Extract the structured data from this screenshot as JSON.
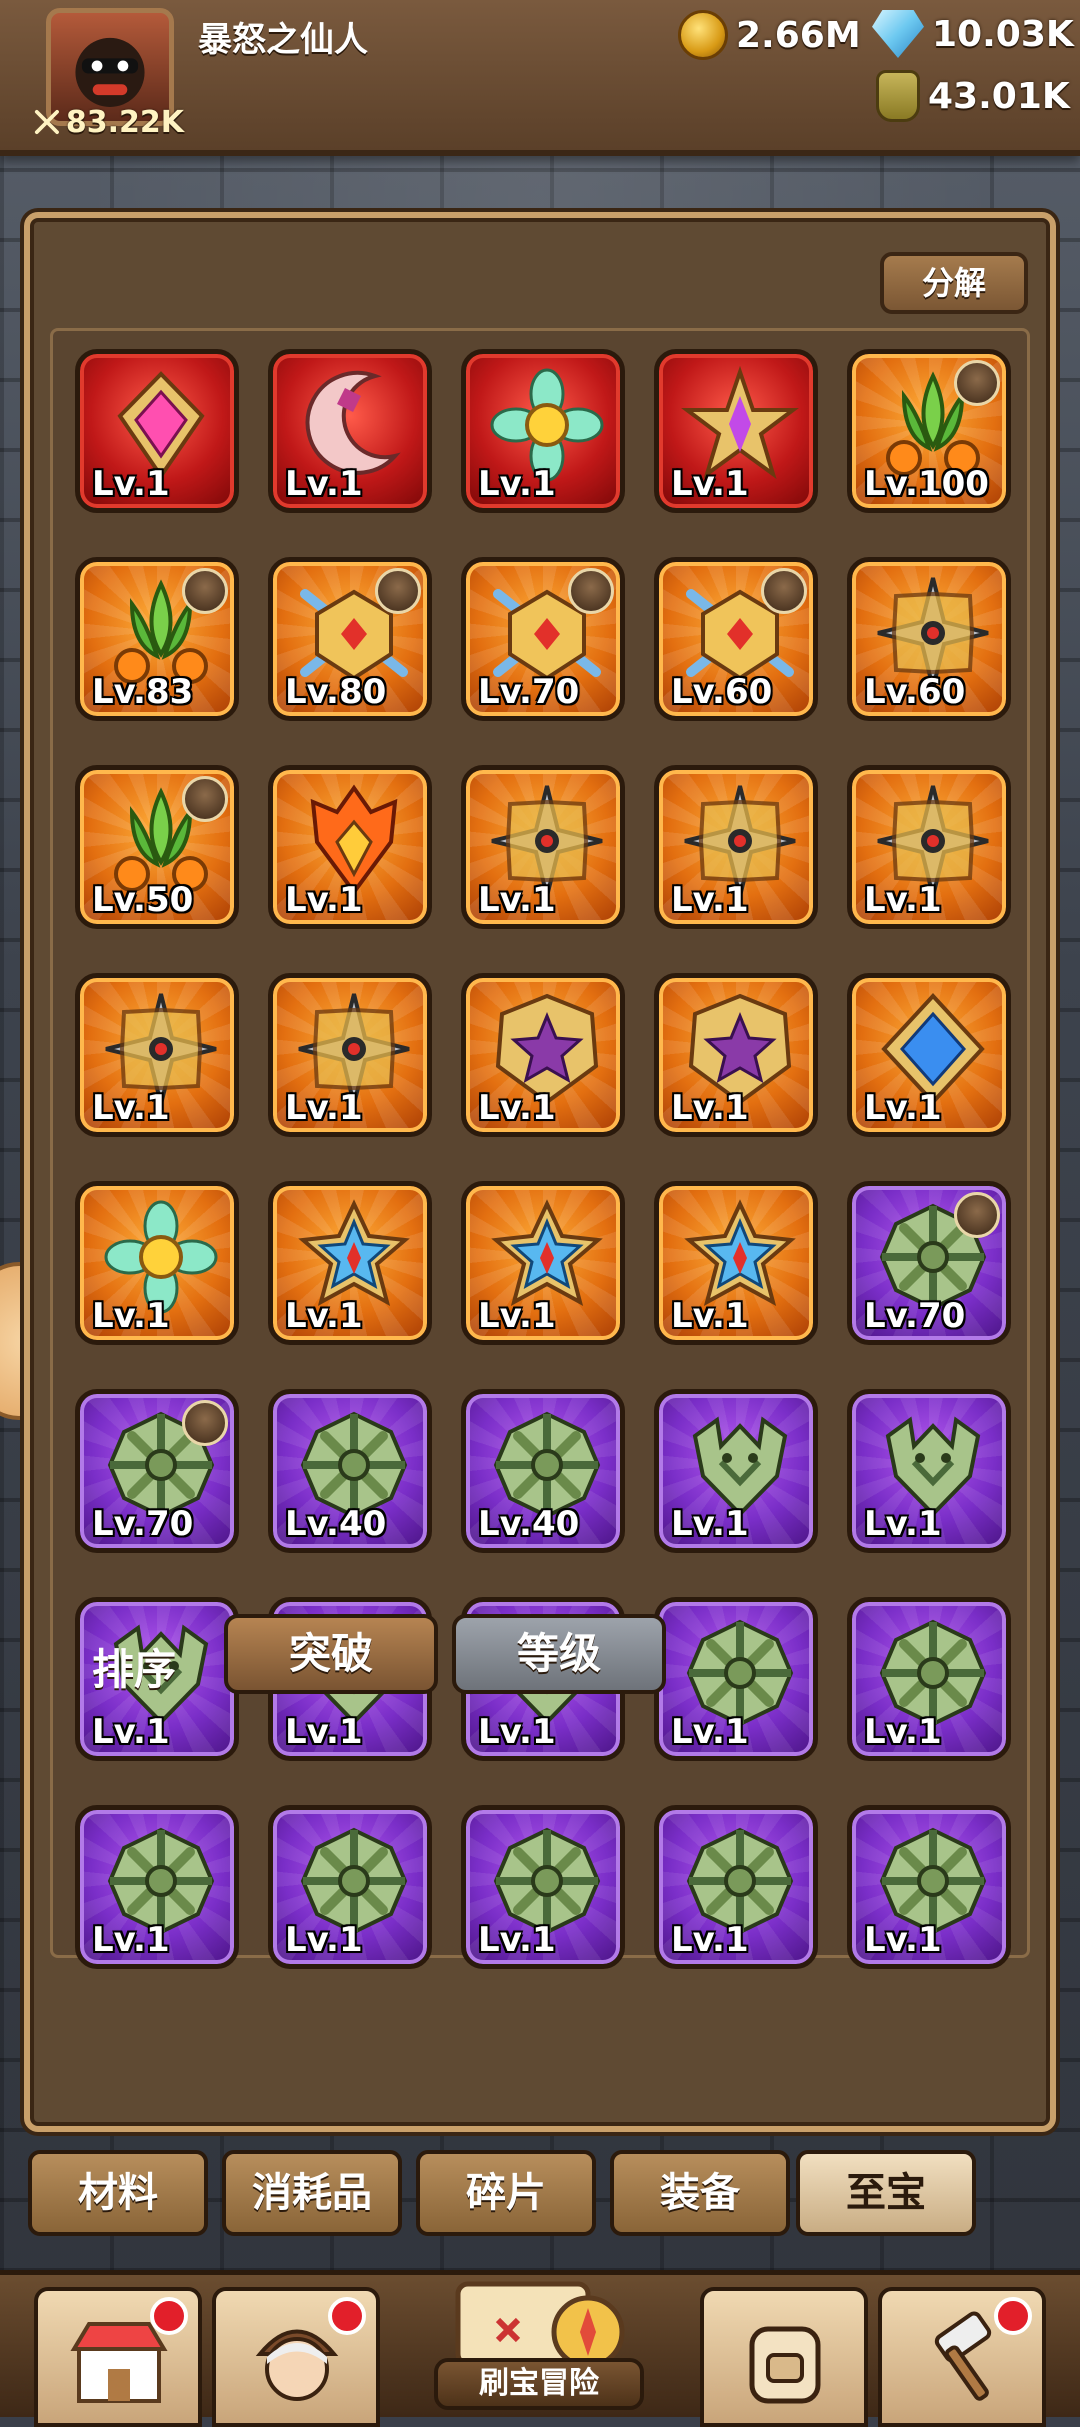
{
  "header": {
    "username": "暴怒之仙人",
    "power": "83.22K",
    "gold": "2.66M",
    "diamonds": "10.03K",
    "potion": "43.01K"
  },
  "panel": {
    "decompose_label": "分解",
    "sort_label": "排序",
    "sort_options": [
      "突破",
      "等级"
    ],
    "sort_selected": "突破"
  },
  "items": [
    {
      "level": "Lv.1",
      "rarity": "red",
      "icon": "pink-gem-icon"
    },
    {
      "level": "Lv.1",
      "rarity": "red",
      "icon": "crescent-moon-icon"
    },
    {
      "level": "Lv.1",
      "rarity": "red",
      "icon": "flower-gem-icon"
    },
    {
      "level": "Lv.1",
      "rarity": "red",
      "icon": "purple-star-icon"
    },
    {
      "level": "Lv.100",
      "rarity": "orange",
      "icon": "leaf-orb-icon",
      "hero": true
    },
    {
      "level": "Lv.83",
      "rarity": "orange",
      "icon": "leaf-orb-icon",
      "hero": true
    },
    {
      "level": "Lv.80",
      "rarity": "orange",
      "icon": "crossed-shield-icon",
      "hero": true
    },
    {
      "level": "Lv.70",
      "rarity": "orange",
      "icon": "crossed-shield-icon",
      "hero": true
    },
    {
      "level": "Lv.60",
      "rarity": "orange",
      "icon": "crossed-shield-icon",
      "hero": true
    },
    {
      "level": "Lv.60",
      "rarity": "orange",
      "icon": "shuriken-icon"
    },
    {
      "level": "Lv.50",
      "rarity": "orange",
      "icon": "leaf-orb-icon",
      "hero": true
    },
    {
      "level": "Lv.1",
      "rarity": "orange",
      "icon": "flame-helmet-icon"
    },
    {
      "level": "Lv.1",
      "rarity": "orange",
      "icon": "shuriken-icon"
    },
    {
      "level": "Lv.1",
      "rarity": "orange",
      "icon": "shuriken-icon"
    },
    {
      "level": "Lv.1",
      "rarity": "orange",
      "icon": "shuriken-icon"
    },
    {
      "level": "Lv.1",
      "rarity": "orange",
      "icon": "shuriken-icon"
    },
    {
      "level": "Lv.1",
      "rarity": "orange",
      "icon": "shuriken-icon"
    },
    {
      "level": "Lv.1",
      "rarity": "orange",
      "icon": "star-badge-icon"
    },
    {
      "level": "Lv.1",
      "rarity": "orange",
      "icon": "star-badge-icon"
    },
    {
      "level": "Lv.1",
      "rarity": "orange",
      "icon": "blue-gem-icon"
    },
    {
      "level": "Lv.1",
      "rarity": "orange",
      "icon": "flower-gem-icon"
    },
    {
      "level": "Lv.1",
      "rarity": "orange",
      "icon": "blue-star-icon"
    },
    {
      "level": "Lv.1",
      "rarity": "orange",
      "icon": "blue-star-icon"
    },
    {
      "level": "Lv.1",
      "rarity": "orange",
      "icon": "blue-star-icon"
    },
    {
      "level": "Lv.70",
      "rarity": "purple",
      "icon": "green-emblem-icon",
      "hero": true
    },
    {
      "level": "Lv.70",
      "rarity": "purple",
      "icon": "green-emblem-icon",
      "hero": true
    },
    {
      "level": "Lv.40",
      "rarity": "purple",
      "icon": "green-emblem-icon"
    },
    {
      "level": "Lv.40",
      "rarity": "purple",
      "icon": "green-emblem-icon"
    },
    {
      "level": "Lv.1",
      "rarity": "purple",
      "icon": "green-dragon-icon"
    },
    {
      "level": "Lv.1",
      "rarity": "purple",
      "icon": "green-dragon-icon"
    },
    {
      "level": "Lv.1",
      "rarity": "purple",
      "icon": "green-dragon-icon"
    },
    {
      "level": "Lv.1",
      "rarity": "purple",
      "icon": "green-dragon-icon"
    },
    {
      "level": "Lv.1",
      "rarity": "purple",
      "icon": "green-dragon-icon"
    },
    {
      "level": "Lv.1",
      "rarity": "purple",
      "icon": "green-emblem-icon"
    },
    {
      "level": "Lv.1",
      "rarity": "purple",
      "icon": "green-emblem-icon"
    },
    {
      "level": "Lv.1",
      "rarity": "purple",
      "icon": "green-emblem-icon"
    },
    {
      "level": "Lv.1",
      "rarity": "purple",
      "icon": "green-emblem-icon"
    },
    {
      "level": "Lv.1",
      "rarity": "purple",
      "icon": "green-emblem-icon"
    },
    {
      "level": "Lv.1",
      "rarity": "purple",
      "icon": "green-emblem-icon"
    },
    {
      "level": "Lv.1",
      "rarity": "purple",
      "icon": "green-emblem-icon"
    }
  ],
  "tabs": [
    {
      "label": "材料",
      "selected": false
    },
    {
      "label": "消耗品",
      "selected": false
    },
    {
      "label": "碎片",
      "selected": false
    },
    {
      "label": "装备",
      "selected": false
    },
    {
      "label": "至宝",
      "selected": true
    }
  ],
  "bottom_nav": {
    "center_label": "刷宝冒险"
  },
  "colors": {
    "panel_bg": "#5f4a33",
    "red_rarity": "#c01818",
    "orange_rarity": "#e36f10",
    "purple_rarity": "#7a2ec8",
    "notification": "#e21f2a"
  }
}
